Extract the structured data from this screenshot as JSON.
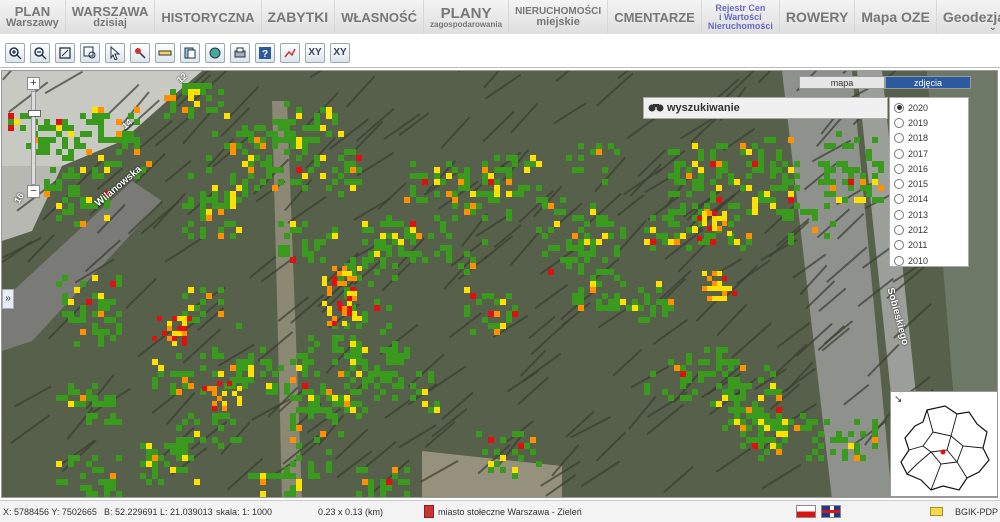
{
  "nav": {
    "tabs": [
      {
        "l1": "PLAN",
        "l2": "Warszawy",
        "kind": "normal"
      },
      {
        "l1": "WARSZAWA",
        "l2": "dzisiaj",
        "kind": "normal"
      },
      {
        "l1": "HISTORYCZNA",
        "l2": "",
        "kind": "normal"
      },
      {
        "l1": "ZABYTKI",
        "l2": "",
        "kind": "big"
      },
      {
        "l1": "WŁASNOŚĆ",
        "l2": "",
        "kind": "normal"
      },
      {
        "l1": "PLANY",
        "l2": "zagospodarowania",
        "kind": "planny"
      },
      {
        "l1": "NIERUCHOMOŚCI",
        "l2": "miejskie",
        "kind": "small"
      },
      {
        "l1": "CMENTARZE",
        "l2": "",
        "kind": "normal"
      },
      {
        "l1": "Rejestr Cen",
        "l2": "i Wartości",
        "l3": "Nieruchomości",
        "kind": "rejestr"
      },
      {
        "l1": "ROWERY",
        "l2": "",
        "kind": "big"
      },
      {
        "l1": "Mapa OZE",
        "l2": "",
        "kind": "big"
      },
      {
        "l1": "Geodezja",
        "l2": "",
        "kind": "big"
      }
    ],
    "expand": "⌄"
  },
  "toolbar": {
    "xy1": "XY",
    "xy2": "XY"
  },
  "map": {
    "streets": [
      "Wilanowska",
      "Sobieskiego"
    ],
    "block_labels": [
      "12",
      "14",
      "16"
    ],
    "basemap": {
      "mapa": "mapa",
      "zdjecia": "zdjęcia"
    },
    "search_label": "wyszukiwanie",
    "years": [
      "2020",
      "2019",
      "2018",
      "2017",
      "2016",
      "2015",
      "2014",
      "2013",
      "2012",
      "2011",
      "2010"
    ],
    "selected_year": "2020",
    "side_toggle": "»",
    "zoom_plus": "+",
    "zoom_minus": "−",
    "overview_arrow": "↘"
  },
  "status": {
    "coords": "X: 5788456 Y: 7502665",
    "geo": "B: 52.229691 L: 21.039013",
    "scale": "skala: 1: 1000",
    "extent": "0.23 x 0.13 (km)",
    "layer": "miasto stołeczne Warszawa - Zieleń",
    "credit": "BGIK-PDP"
  },
  "colors": {
    "vegetation": "#3a9a1e",
    "yellow": "#ffe000",
    "orange": "#ff9000",
    "red": "#e01010",
    "accent": "#2c5aa0"
  }
}
